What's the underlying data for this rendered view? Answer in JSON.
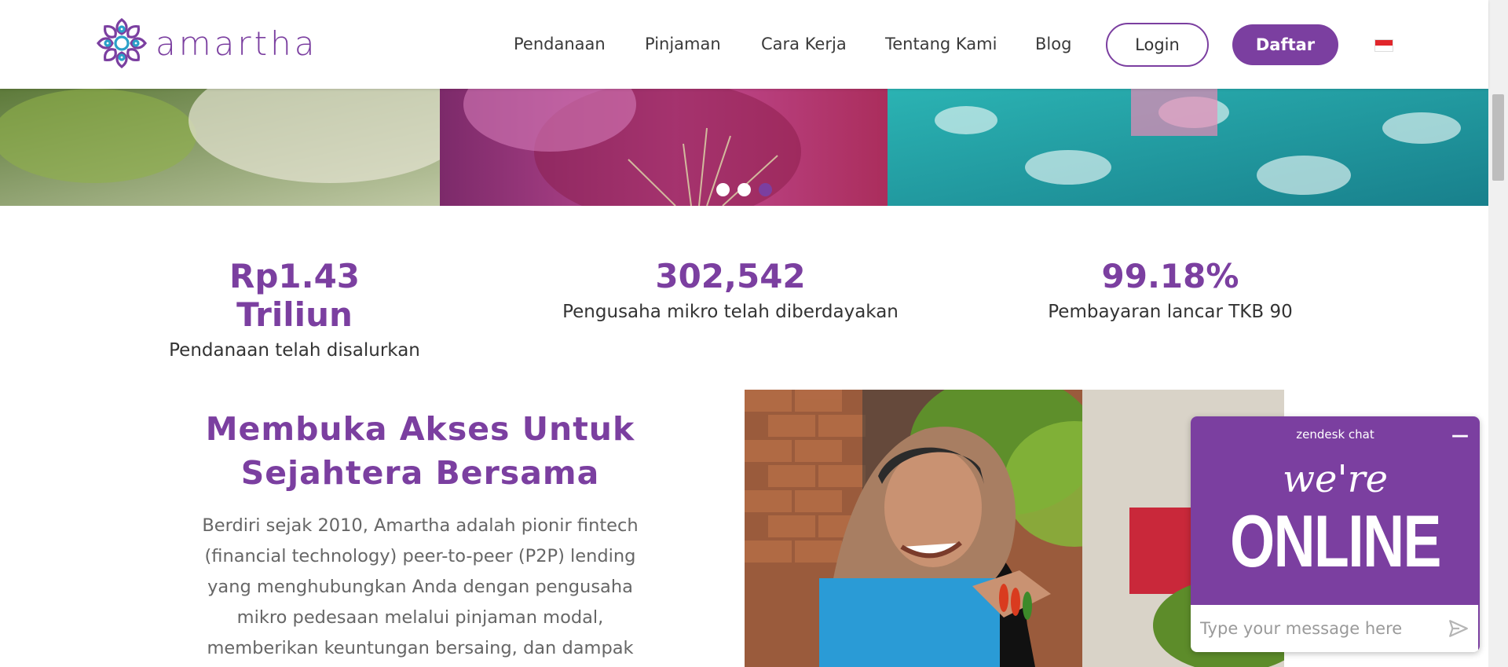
{
  "brand": {
    "name": "amartha",
    "color": "#7b3fa0"
  },
  "nav": {
    "items": [
      {
        "label": "Pendanaan"
      },
      {
        "label": "Pinjaman"
      },
      {
        "label": "Cara Kerja"
      },
      {
        "label": "Tentang Kami"
      },
      {
        "label": "Blog"
      }
    ],
    "login_label": "Login",
    "signup_label": "Daftar",
    "language_flag": "indonesia-flag-icon"
  },
  "hero": {
    "slides_count": 3,
    "active_slide": 3
  },
  "stats": [
    {
      "value": "Rp1.43 Triliun",
      "label": "Pendanaan telah disalurkan"
    },
    {
      "value": "302,542",
      "label": "Pengusaha mikro telah diberdayakan"
    },
    {
      "value": "99.18%",
      "label": "Pembayaran lancar TKB 90"
    }
  ],
  "about": {
    "title": "Membuka Akses Untuk Sejahtera Bersama",
    "body": "Berdiri sejak 2010, Amartha adalah pionir fintech (financial technology) peer-to-peer (P2P) lending yang menghubungkan Anda dengan pengusaha mikro pedesaan melalui pinjaman modal, memberikan keuntungan bersaing, dan dampak"
  },
  "chat": {
    "brand": "zendesk chat",
    "headline_top": "we're",
    "headline_bottom": "ONLINE",
    "input_placeholder": "Type your message here"
  }
}
